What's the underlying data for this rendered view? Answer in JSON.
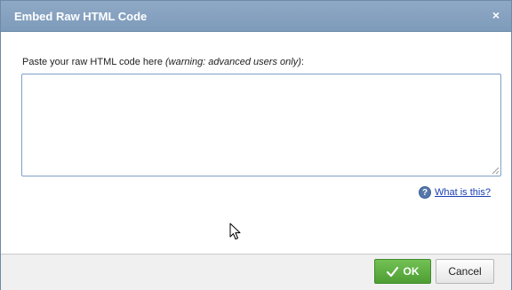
{
  "dialog": {
    "title": "Embed Raw HTML Code",
    "close_symbol": "×"
  },
  "form": {
    "label_main": "Paste your raw HTML code here ",
    "label_note": "(warning: advanced users only)",
    "label_suffix": ":",
    "textarea_value": ""
  },
  "help": {
    "icon": "question-icon",
    "icon_glyph": "?",
    "link_text": "What is this?"
  },
  "footer": {
    "ok_label": "OK",
    "cancel_label": "Cancel",
    "ok_icon": "checkmark-icon"
  },
  "colors": {
    "titlebar": "#8fa9c5",
    "ok_button": "#5aad3e",
    "link": "#1a3fb3"
  }
}
